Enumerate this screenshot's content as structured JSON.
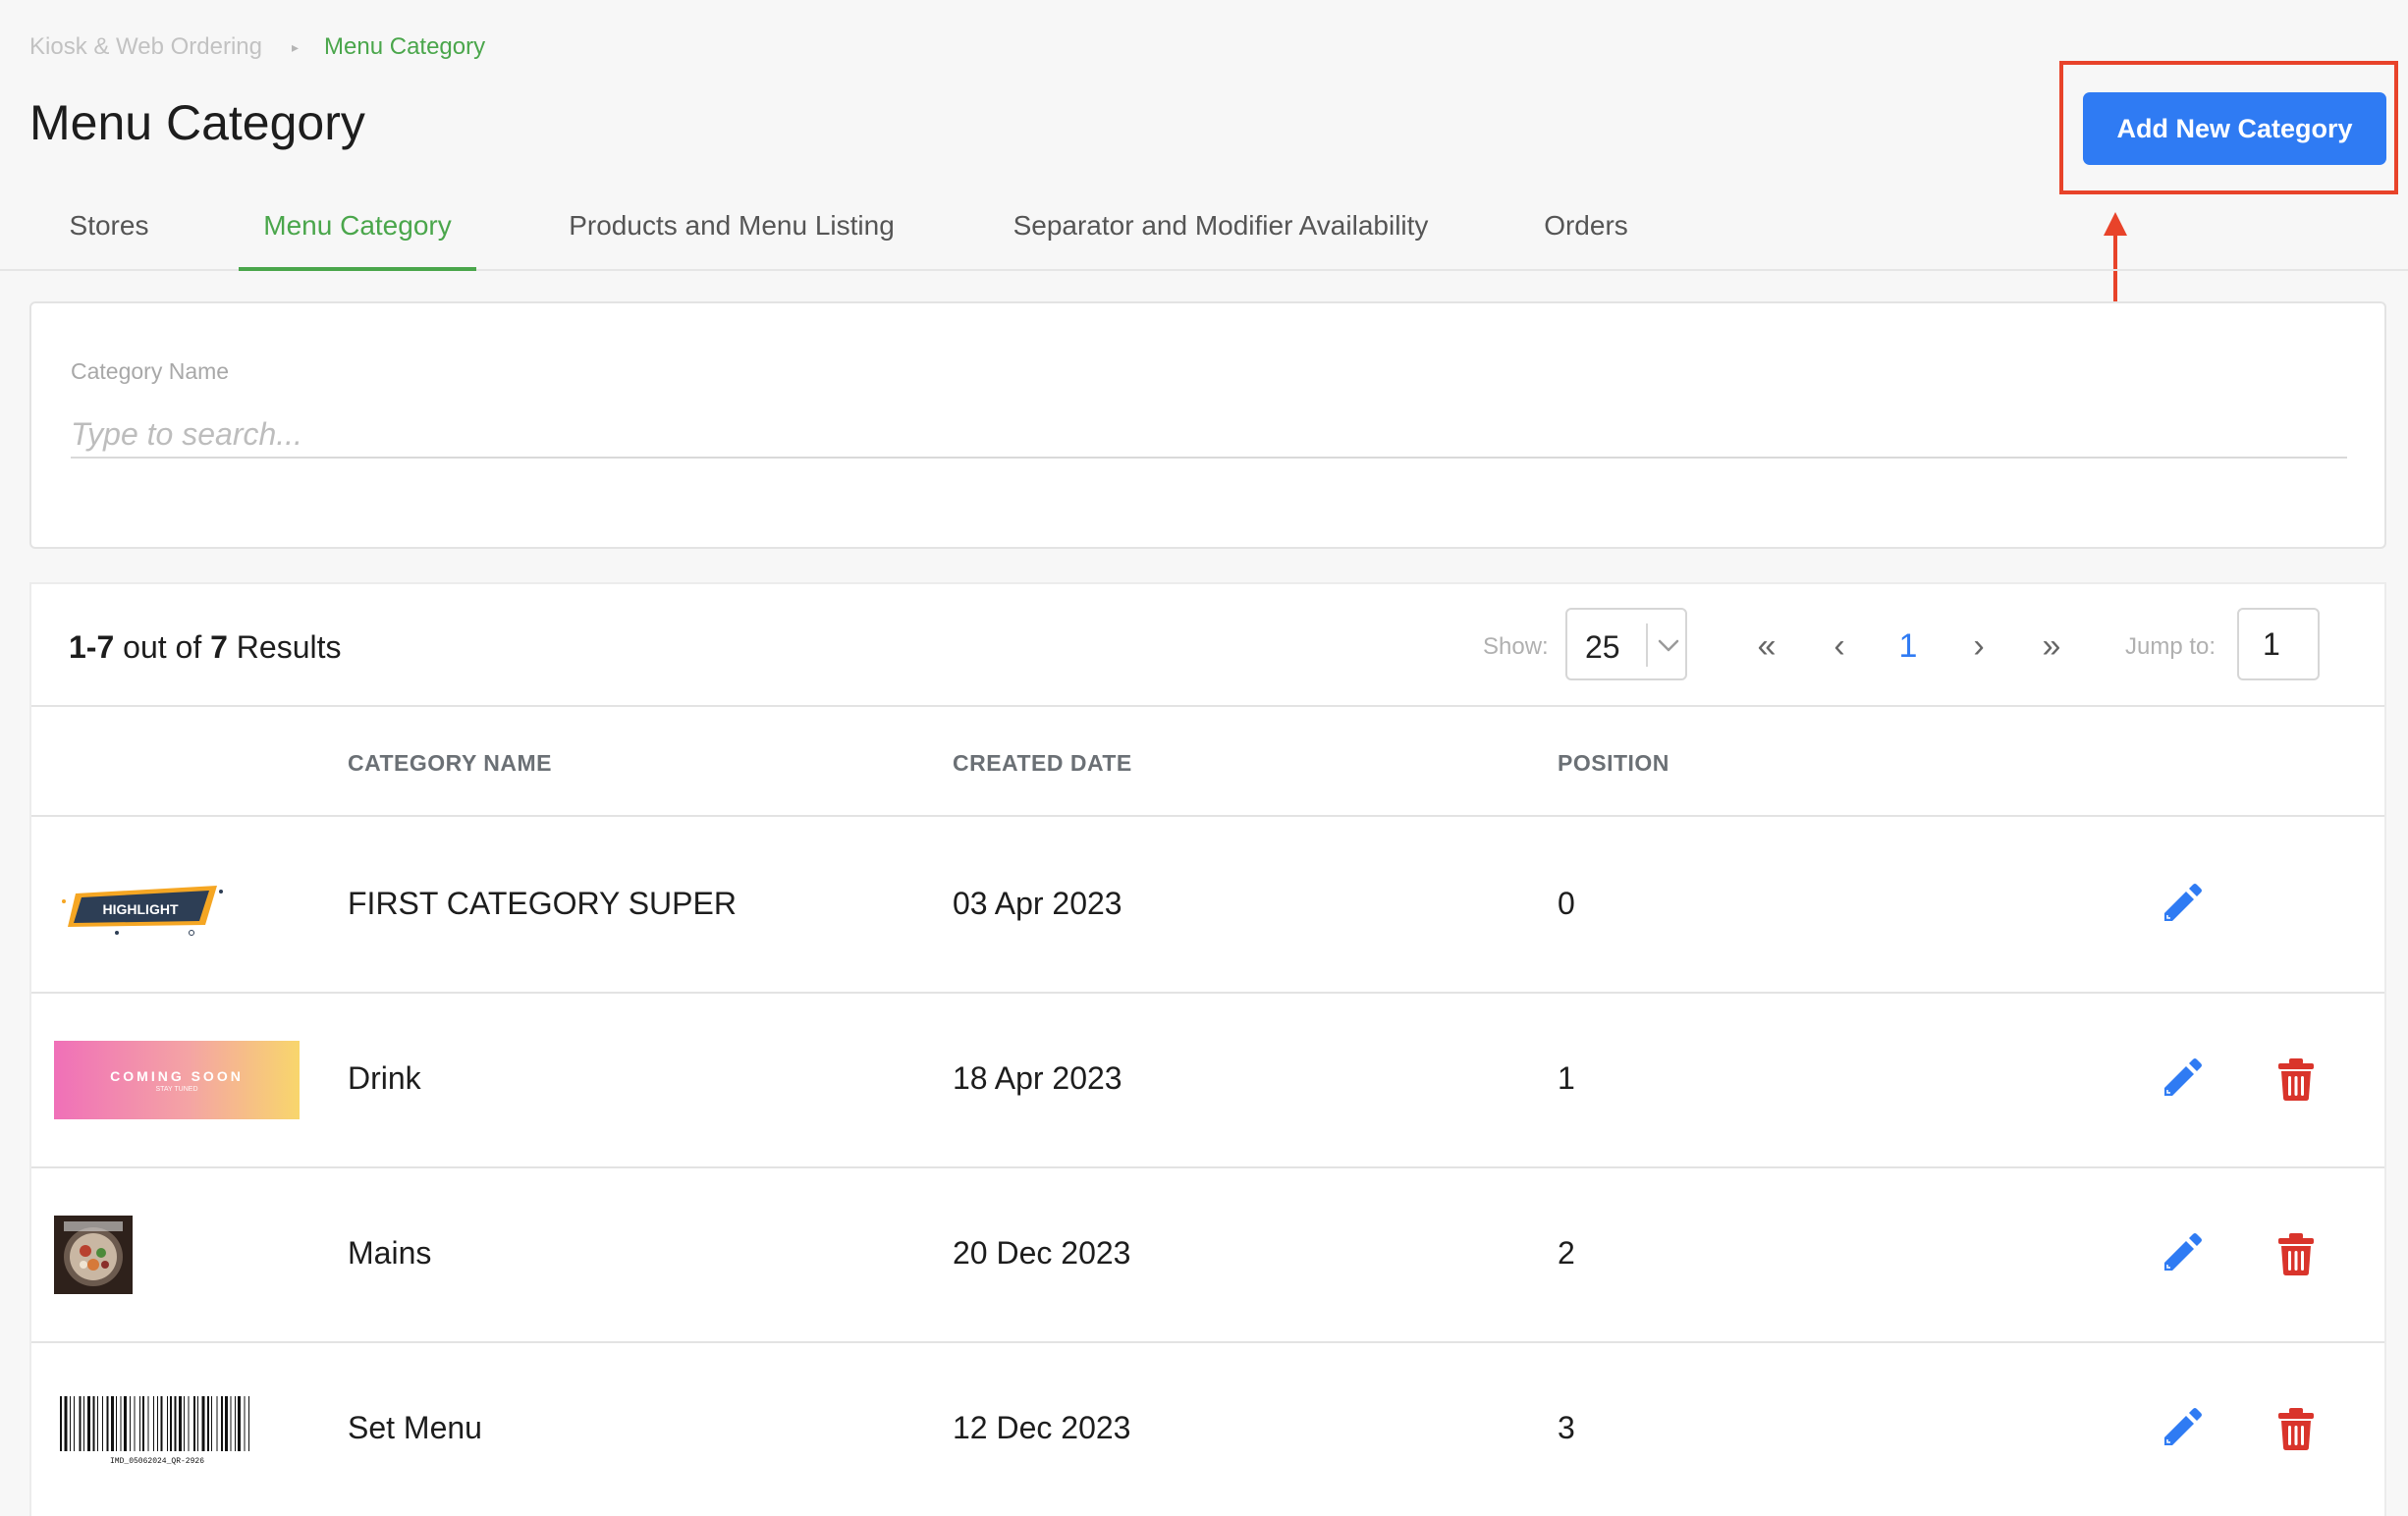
{
  "breadcrumb": {
    "root": "Kiosk & Web Ordering",
    "separator": "▸",
    "current": "Menu Category"
  },
  "page": {
    "title": "Menu Category"
  },
  "actions": {
    "add_button": "Add New Category"
  },
  "tabs": [
    {
      "label": "Stores",
      "active": false
    },
    {
      "label": "Menu Category",
      "active": true
    },
    {
      "label": "Products and Menu Listing",
      "active": false
    },
    {
      "label": "Separator and Modifier Availability",
      "active": false
    },
    {
      "label": "Orders",
      "active": false
    }
  ],
  "search": {
    "label": "Category Name",
    "placeholder": "Type to search...",
    "value": ""
  },
  "results": {
    "range": "1-7",
    "out_of": "out of",
    "total": "7",
    "suffix": "Results",
    "show_label": "Show:",
    "page_size": "25",
    "pager": {
      "first": "«",
      "prev": "‹",
      "current": "1",
      "next": "›",
      "last": "»"
    },
    "jump_label": "Jump to:",
    "jump_value": "1"
  },
  "table": {
    "columns": {
      "name": "CATEGORY NAME",
      "created": "CREATED DATE",
      "position": "POSITION"
    },
    "rows": [
      {
        "name": "FIRST CATEGORY SUPER",
        "created": "03 Apr 2023",
        "position": "0",
        "thumb": "highlight-banner",
        "thumb_text": "HIGHLIGHT",
        "deletable": false
      },
      {
        "name": "Drink",
        "created": "18 Apr 2023",
        "position": "1",
        "thumb": "coming-soon-banner",
        "thumb_text": "COMING SOON",
        "thumb_subtext": "STAY TUNED",
        "deletable": true
      },
      {
        "name": "Mains",
        "created": "20 Dec 2023",
        "position": "2",
        "thumb": "food-photo",
        "deletable": true
      },
      {
        "name": "Set Menu",
        "created": "12 Dec 2023",
        "position": "3",
        "thumb": "barcode",
        "thumb_text": "IMD_05062024_QR-2926",
        "deletable": true
      }
    ]
  },
  "colors": {
    "accent_green": "#4aa64b",
    "primary_blue": "#2f7bf3",
    "delete_red": "#d9342b",
    "annotation_red": "#e8432a"
  }
}
